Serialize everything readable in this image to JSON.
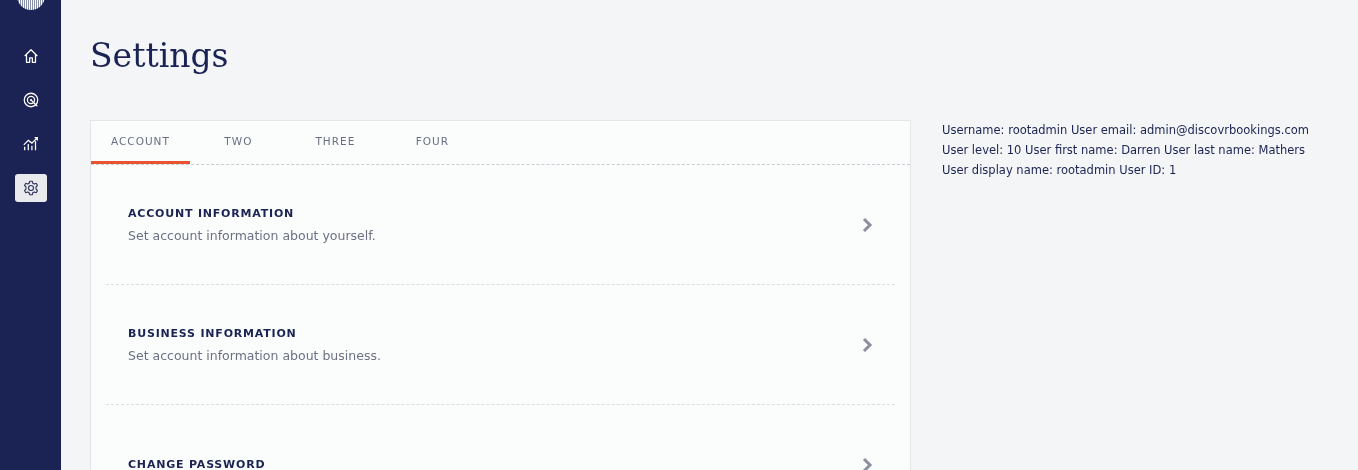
{
  "sidebar": {
    "items": [
      {
        "kind": "home",
        "selected": false
      },
      {
        "kind": "target",
        "selected": false
      },
      {
        "kind": "chart",
        "selected": false
      },
      {
        "kind": "gear",
        "selected": true
      }
    ]
  },
  "page_title": "Settings",
  "tabs": [
    {
      "label": "ACCOUNT",
      "selected": true
    },
    {
      "label": "TWO",
      "selected": false
    },
    {
      "label": "THREE",
      "selected": false
    },
    {
      "label": "FOUR",
      "selected": false
    }
  ],
  "settings_items": [
    {
      "title": "ACCOUNT INFORMATION",
      "description": "Set account information about yourself."
    },
    {
      "title": "BUSINESS INFORMATION",
      "description": "Set account information about business."
    },
    {
      "title": "CHANGE PASSWORD"
    }
  ],
  "user_info": "Username: rootadmin User email: admin@discovrbookings.com User level: 10 User first name: Darren User last name: Mathers User display name: rootadmin User ID: 1"
}
